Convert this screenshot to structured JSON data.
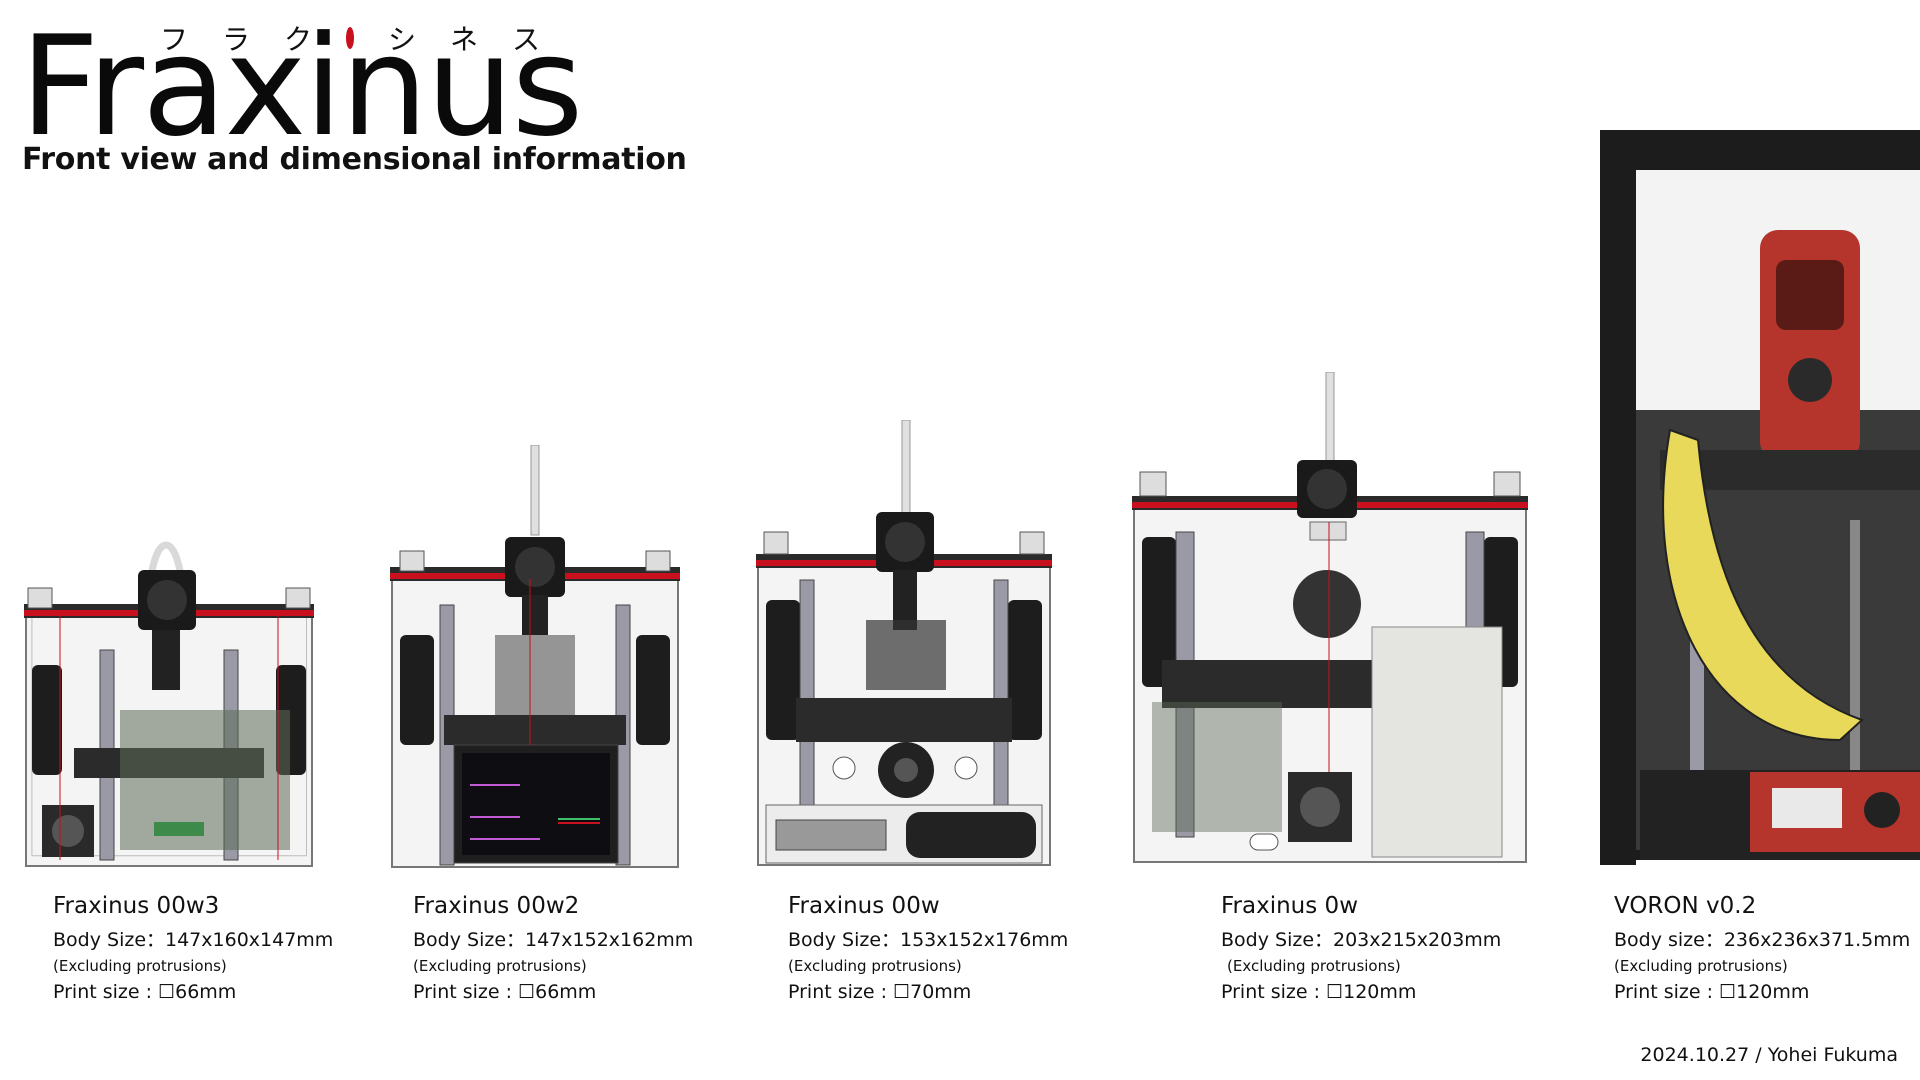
{
  "header": {
    "title": "Fraxinus",
    "kana": [
      "フ",
      "ラ",
      "ク",
      "シ",
      "ネ",
      "ス"
    ],
    "subtitle": "Front view and dimensional information"
  },
  "colors": {
    "accent_red": "#c8101e",
    "frame_black": "#1c1c1c",
    "voron_red": "#b5352c",
    "banana_yellow": "#e8d95a"
  },
  "printers": [
    {
      "name": "Fraxinus 00w3",
      "body_size": "Body Size：147x160x147mm",
      "excluding": "(Excluding protrusions)",
      "print_size": "Print size : ☐66mm"
    },
    {
      "name": "Fraxinus 00w2",
      "body_size": "Body Size：147x152x162mm",
      "excluding": "(Excluding protrusions)",
      "print_size": "Print size : ☐66mm"
    },
    {
      "name": "Fraxinus 00w",
      "body_size": "Body Size：153x152x176mm",
      "excluding": "(Excluding protrusions)",
      "print_size": "Print size : ☐70mm"
    },
    {
      "name": "Fraxinus 0w",
      "body_size": "Body Size：203x215x203mm",
      "excluding": "(Excluding protrusions)",
      "print_size": "Print size : ☐120mm"
    },
    {
      "name": "VORON v0.2",
      "body_size": "Body size：236x236x371.5mm",
      "excluding": "(Excluding protrusions)",
      "print_size": "Print size : ☐120mm"
    }
  ],
  "footer": {
    "credit": "2024.10.27 / Yohei  Fukuma"
  }
}
